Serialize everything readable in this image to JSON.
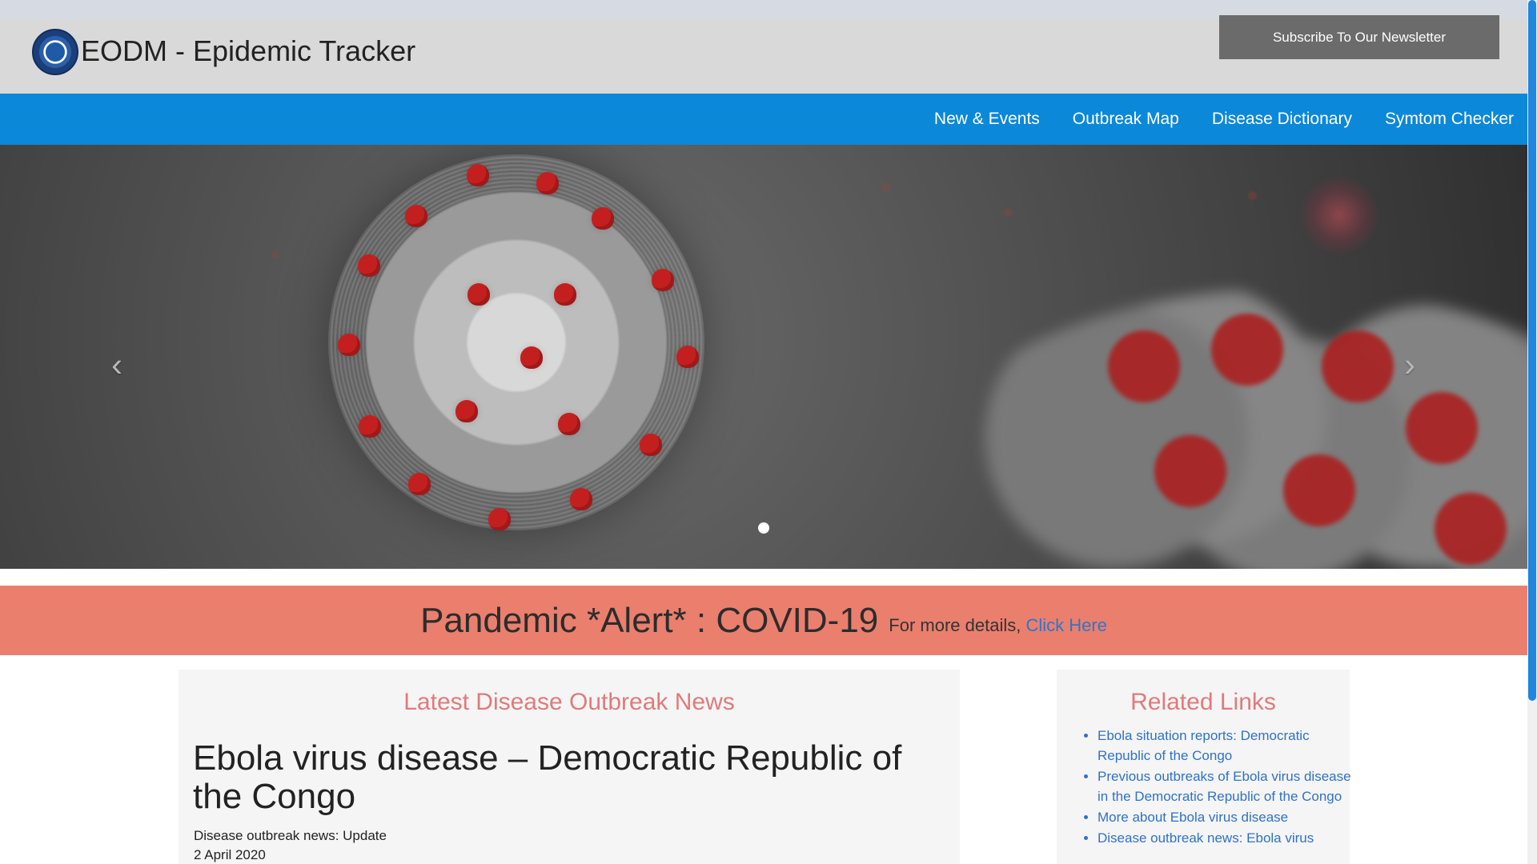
{
  "site": {
    "title": "EODM - Epidemic Tracker",
    "newsletter_button_label": "Subscribe To Our Newsletter"
  },
  "navigation": {
    "items": [
      {
        "label": "New & Events"
      },
      {
        "label": "Outbreak Map"
      },
      {
        "label": "Disease Dictionary"
      },
      {
        "label": "Symtom Checker"
      }
    ]
  },
  "hero": {
    "prev_icon": "chevron-left-icon",
    "next_icon": "chevron-right-icon",
    "active_slide_indicator": 1
  },
  "alert": {
    "title": "Pandemic *Alert* : COVID-19",
    "details_prefix": "For more details, ",
    "link_label": "Click Here"
  },
  "latest_news": {
    "heading": "Latest Disease Outbreak News",
    "story_title": "Ebola virus disease – Democratic Republic of the Congo",
    "kind": "Disease outbreak news: Update",
    "date": "2 April 2020"
  },
  "related_links": {
    "heading": "Related Links",
    "items": [
      {
        "label": "Ebola situation reports: Democratic Republic of the Congo"
      },
      {
        "label": "Previous outbreaks of Ebola virus disease in the Democratic Republic of the Congo"
      },
      {
        "label": "More about Ebola virus disease"
      },
      {
        "label": "Disease outbreak news: Ebola virus"
      }
    ]
  },
  "colors": {
    "browser_strip": "#d6dae2",
    "header": "#d9d9d9",
    "nav": "#0b88d8",
    "newsletter_button": "#6b6b6b",
    "alert": "#ea7f6e",
    "link": "#2f72c7",
    "section_heading": "#e07b7b",
    "scroll_thumb": "#1f87dd"
  }
}
